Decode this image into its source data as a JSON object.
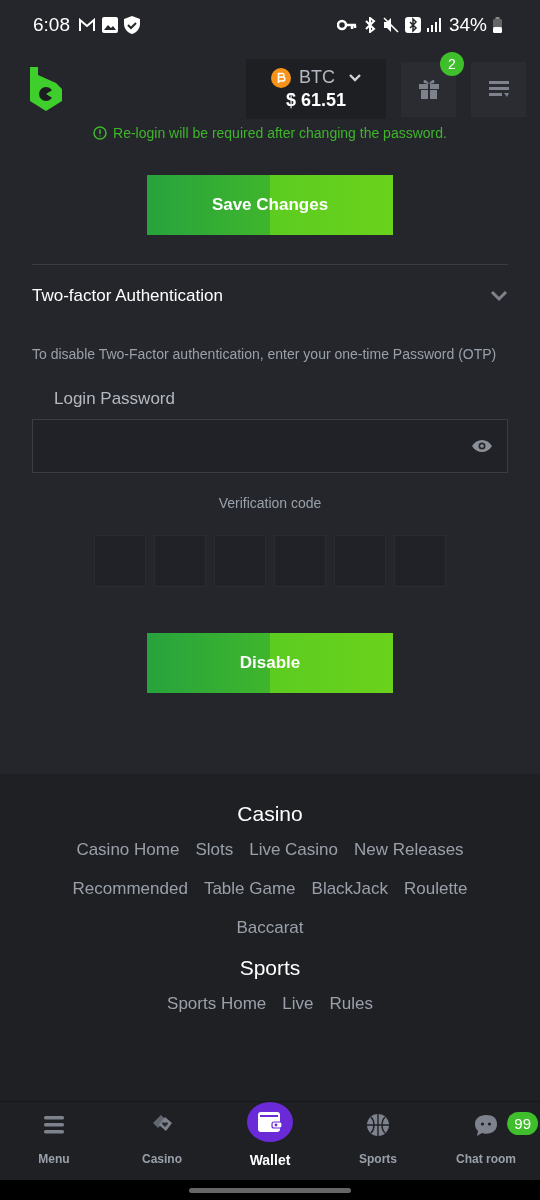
{
  "status_bar": {
    "time": "6:08",
    "battery": "34%"
  },
  "header": {
    "currency": "BTC",
    "balance": "$ 61.51",
    "gift_badge": "2"
  },
  "notice": "Re-login will be required after changing the password.",
  "save_button": "Save Changes",
  "two_factor": {
    "title": "Two-factor Authentication",
    "expanded": true,
    "description": "To disable Two-Factor authentication, enter your one-time Password (OTP)",
    "password_label": "Login Password",
    "verification_label": "Verification code",
    "disable_button": "Disable"
  },
  "footer": [
    {
      "title": "Casino",
      "links": [
        "Casino Home",
        "Slots",
        "Live Casino",
        "New Releases",
        "Recommended",
        "Table Game",
        "BlackJack",
        "Roulette",
        "Baccarat"
      ]
    },
    {
      "title": "Sports",
      "links": [
        "Sports Home",
        "Live",
        "Rules"
      ]
    }
  ],
  "bottom_nav": [
    {
      "kind": "menu",
      "label": "Menu",
      "selected": false
    },
    {
      "kind": "casino",
      "label": "Casino",
      "selected": false
    },
    {
      "kind": "wallet",
      "label": "Wallet",
      "selected": true
    },
    {
      "kind": "sports",
      "label": "Sports",
      "selected": false
    },
    {
      "kind": "chat",
      "label": "Chat room",
      "selected": false,
      "badge": "99"
    }
  ]
}
